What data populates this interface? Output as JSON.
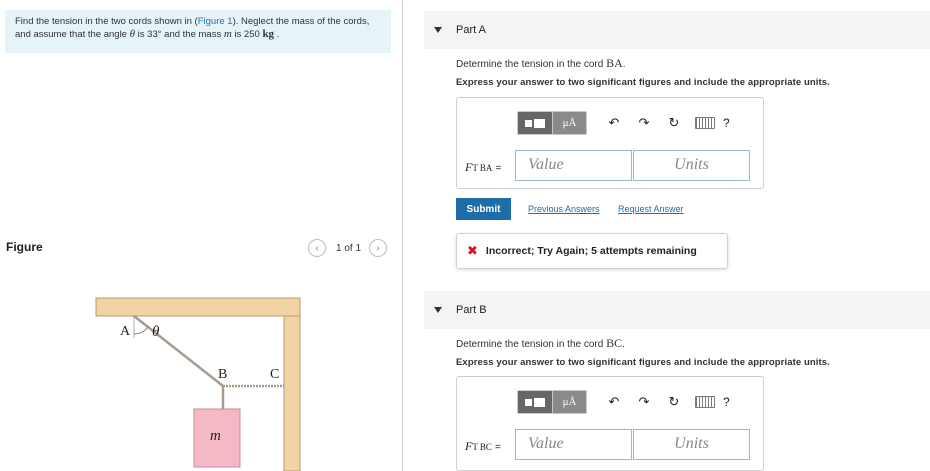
{
  "problem": {
    "text_1": "Find the tension in the two cords shown in (",
    "figure_link": "Figure 1",
    "text_2": "). Neglect the mass of the cords, and assume that the angle ",
    "theta": "θ",
    "text_3": " is 33° and the mass ",
    "m": "m",
    "text_4": " is 250 ",
    "unit": "kg",
    "text_5": " ."
  },
  "figure": {
    "label": "Figure",
    "pager": "1 of 1",
    "prev_icon": "chevron-left-icon",
    "next_icon": "chevron-right-icon",
    "point_a": "A",
    "point_b": "B",
    "point_c": "C",
    "angle": "θ",
    "mass": "m",
    "colors": {
      "wall": "#f2d3a6",
      "wall_border": "#b89a73",
      "mass": "#f4b9c4",
      "mass_border": "#c8899a",
      "cord": "#a89b8e"
    }
  },
  "part_a": {
    "title": "Part A",
    "question_1": "Determine the tension in the cord ",
    "question_var": "BA",
    "question_2": ".",
    "instruction": "Express your answer to two significant figures and include the appropriate units.",
    "toolbar": {
      "mu": "μÅ",
      "undo": "↶",
      "redo": "↷",
      "reset": "↻",
      "help": "?"
    },
    "var_main": "F",
    "var_sub": "T BA",
    "equals": "=",
    "value_placeholder": "Value",
    "units_placeholder": "Units",
    "submit": "Submit",
    "previous_answers": "Previous Answers",
    "request_answer": "Request Answer",
    "feedback": "Incorrect; Try Again; 5 attempts remaining",
    "feedback_icon": "✖"
  },
  "part_b": {
    "title": "Part B",
    "question_1": "Determine the tension in the cord ",
    "question_var": "BC",
    "question_2": ".",
    "instruction": "Express your answer to two significant figures and include the appropriate units.",
    "toolbar": {
      "mu": "μÅ",
      "undo": "↶",
      "redo": "↷",
      "reset": "↻",
      "help": "?"
    },
    "var_main": "F",
    "var_sub": "T BC",
    "equals": "=",
    "value_placeholder": "Value",
    "units_placeholder": "Units"
  },
  "colors": {
    "accent": "#1f6da8",
    "problem_bg": "#e6f3f8",
    "error": "#d2161c",
    "part_header_bg": "#f4f4f4"
  }
}
